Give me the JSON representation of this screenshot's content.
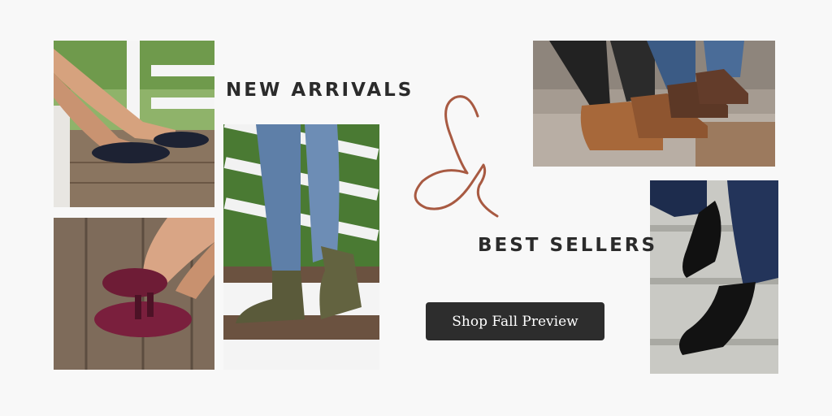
{
  "headings": {
    "new_arrivals": "NEW ARRIVALS",
    "best_sellers": "BEST SELLERS"
  },
  "ampersand": "&",
  "cta": {
    "label": "Shop Fall Preview"
  },
  "colors": {
    "background": "#f8f8f8",
    "heading_text": "#2b2b2b",
    "ampersand": "#a85a42",
    "button_bg": "#2d2d2d",
    "button_text": "#ffffff"
  },
  "photos": [
    {
      "id": "photo-navy-flats"
    },
    {
      "id": "photo-burgundy-mary-janes"
    },
    {
      "id": "photo-olive-ankle-boots"
    },
    {
      "id": "photo-brown-clogs"
    },
    {
      "id": "photo-black-slip-ons"
    }
  ]
}
